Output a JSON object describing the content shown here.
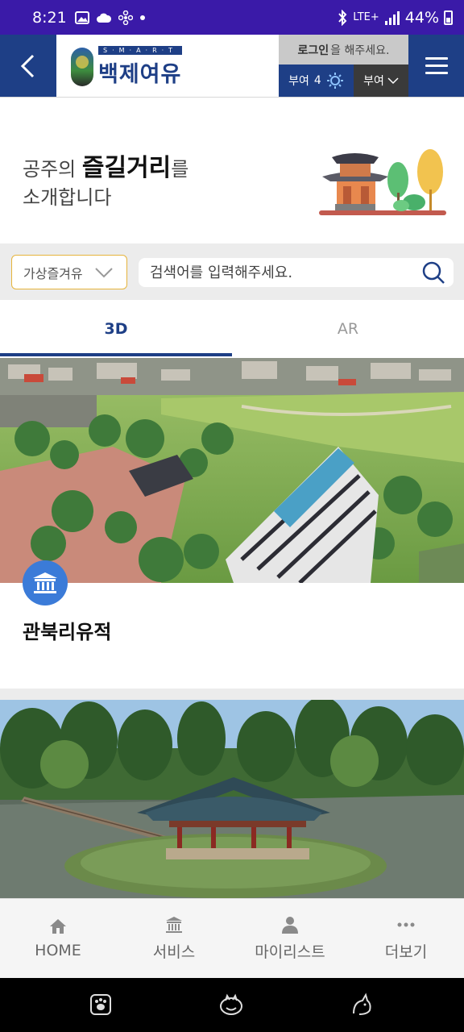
{
  "status_bar": {
    "time": "8:21",
    "network": "LTE+",
    "battery": "44%"
  },
  "header": {
    "logo_small": "S·M·A·R·T",
    "logo_name": "백제여유",
    "login_bold": "로그인",
    "login_rest": "을 해주세요.",
    "weather_region": "부여",
    "weather_temp": "4",
    "region_select": "부여"
  },
  "intro": {
    "prefix": "공주의 ",
    "highlight": "즐길거리",
    "suffix": "를",
    "line2": "소개합니다"
  },
  "search": {
    "category": "가상즐겨유",
    "placeholder": "검색어를 입력해주세요."
  },
  "tabs": [
    {
      "label": "3D",
      "active": true
    },
    {
      "label": "AR",
      "active": false
    }
  ],
  "cards": [
    {
      "title": "관북리유적",
      "badge_icon": "heritage-building-icon"
    },
    {
      "title": "",
      "badge_icon": ""
    }
  ],
  "bottom_nav": [
    {
      "label": "HOME",
      "icon": "home-icon"
    },
    {
      "label": "서비스",
      "icon": "building-icon"
    },
    {
      "label": "마이리스트",
      "icon": "person-icon"
    },
    {
      "label": "더보기",
      "icon": "more-dots-icon"
    }
  ],
  "colors": {
    "status_bar": "#3a1aa8",
    "primary": "#1e3f86",
    "category_border": "#e6b43c",
    "badge": "#3b7bd8"
  }
}
